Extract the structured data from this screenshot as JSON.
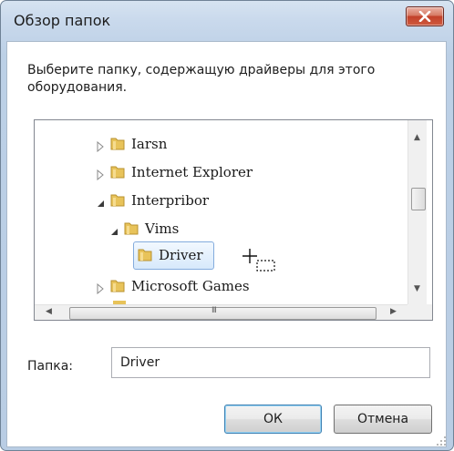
{
  "dialog": {
    "title": "Обзор папок",
    "instruction": "Выберите папку, содержащую драйверы для этого оборудования."
  },
  "tree": {
    "items": [
      {
        "label": "Iarsn",
        "expanded": false,
        "level": 1
      },
      {
        "label": "Internet Explorer",
        "expanded": false,
        "level": 1
      },
      {
        "label": "Interpribor",
        "expanded": true,
        "level": 1
      },
      {
        "label": "Vims",
        "expanded": true,
        "level": 2
      },
      {
        "label": "Driver",
        "expanded": null,
        "level": 3,
        "selected": true
      },
      {
        "label": "Microsoft Games",
        "expanded": false,
        "level": 1
      }
    ],
    "hscroll_grip": "III"
  },
  "folder_field": {
    "label": "Папка:",
    "value": "Driver"
  },
  "buttons": {
    "ok": "ОК",
    "cancel": "Отмена"
  },
  "colors": {
    "close_button": "#c2412a",
    "selection_border": "#84acdd",
    "folder_yellow": "#e8c35a"
  },
  "icons": {
    "close": "close-icon",
    "folder": "folder-icon",
    "collapsed": "triangle-right-icon",
    "expanded": "triangle-down-icon",
    "cursor": "drag-move-cursor-icon"
  }
}
